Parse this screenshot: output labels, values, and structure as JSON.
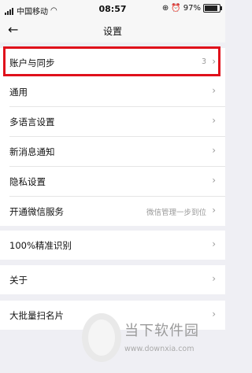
{
  "status_bar": {
    "carrier": "中国移动",
    "time": "08:57",
    "battery": "97%"
  },
  "nav": {
    "title": "设置"
  },
  "groups": [
    {
      "items": [
        {
          "label": "账户与同步",
          "value": "3"
        }
      ]
    },
    {
      "items": [
        {
          "label": "通用",
          "value": ""
        },
        {
          "label": "多语言设置",
          "value": ""
        },
        {
          "label": "新消息通知",
          "value": ""
        },
        {
          "label": "隐私设置",
          "value": ""
        },
        {
          "label": "开通微信服务",
          "value": "微信管理一步到位"
        }
      ]
    },
    {
      "items": [
        {
          "label": "100%精准识别",
          "value": ""
        }
      ]
    },
    {
      "items": [
        {
          "label": "关于",
          "value": ""
        }
      ]
    },
    {
      "items": [
        {
          "label": "大批量扫名片",
          "value": ""
        }
      ]
    }
  ],
  "chevron": "›",
  "watermark": {
    "brand": "当下软件园",
    "url": "www.downxia.com"
  },
  "highlight_color": "#e0101b",
  "icons": [
    "back-arrow-icon",
    "chevron-right-icon",
    "wifi-icon",
    "alarm-icon",
    "lock-rotation-icon",
    "battery-icon"
  ]
}
